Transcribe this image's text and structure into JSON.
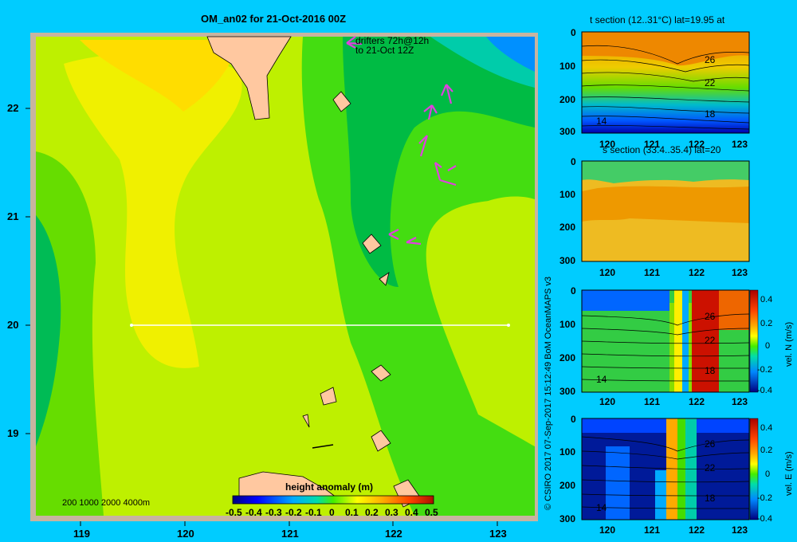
{
  "map": {
    "title": "OM_an02 for 21-Oct-2016 00Z",
    "drifters_label_1": "drifters 72h@12h",
    "drifters_label_2": "to 21-Oct 12Z",
    "lon_ticks": [
      "119",
      "120",
      "121",
      "122",
      "123"
    ],
    "lat_ticks": [
      "22",
      "21",
      "20",
      "19"
    ],
    "depth_legend": "200  1000  2000  4000m",
    "colorbar_title": "height anomaly  (m)",
    "colorbar_ticks": [
      "-0.5",
      "-0.4",
      "-0.3",
      "-0.2",
      "-0.1",
      "0",
      "0.1",
      "0.2",
      "0.3",
      "0.4",
      "0.5"
    ]
  },
  "credit": "© CSIRO 2017   07-Sep-2017 15:12:49 BoM OceanMAPS v3",
  "panels": [
    {
      "title": "t section (12..31°C) lat=19.95 at",
      "contours": [
        "26",
        "22",
        "18",
        "14"
      ],
      "colorbar": null
    },
    {
      "title": "s section (33.4..35.4) lat=20",
      "contours": [],
      "colorbar": null
    },
    {
      "title": "",
      "contours": [
        "26",
        "22",
        "18",
        "14"
      ],
      "colorbar": {
        "label": "vel. N (m/s)",
        "ticks": [
          "0.4",
          "0.2",
          "0",
          "-0.2",
          "-0.4"
        ]
      }
    },
    {
      "title": "",
      "contours": [
        "26",
        "22",
        "18",
        "14"
      ],
      "colorbar": {
        "label": "vel. E (m/s)",
        "ticks": [
          "0.4",
          "0.2",
          "0",
          "-0.2",
          "-0.4"
        ]
      }
    }
  ],
  "section_axes": {
    "x_ticks": [
      "120",
      "121",
      "122",
      "123"
    ],
    "y_ticks": [
      "0",
      "100",
      "200",
      "300"
    ]
  },
  "colors": {
    "background": "#00ccff",
    "land": "#ffc8a0",
    "map_frame": "#c8b4a0",
    "drifters": "#e040e0"
  }
}
